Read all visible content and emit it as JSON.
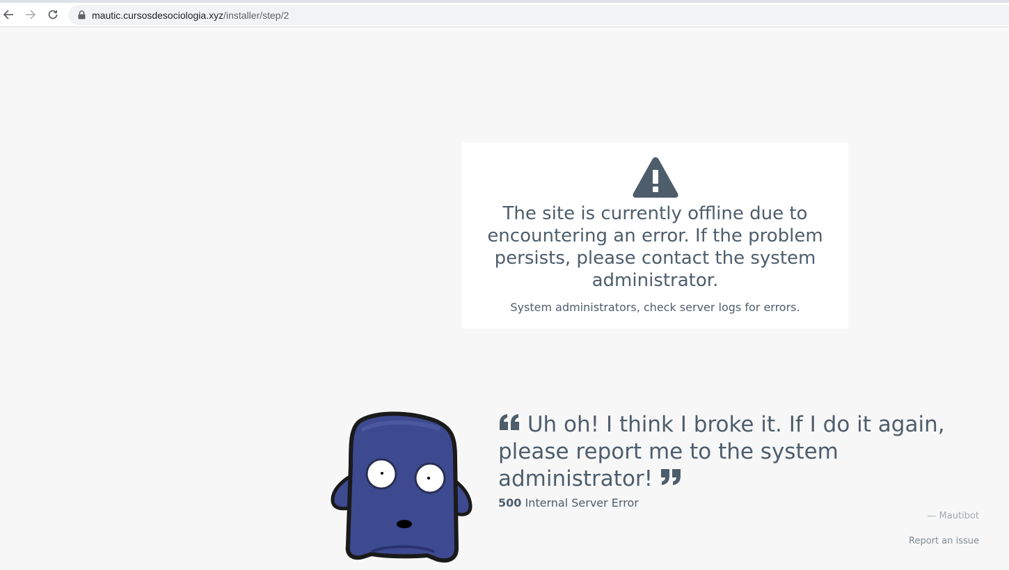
{
  "browser": {
    "url_host": "mautic.cursosdesociologia.xyz",
    "url_path": "/installer/step/2",
    "back_icon": "arrow-left-icon",
    "forward_icon": "arrow-right-icon",
    "reload_icon": "reload-icon",
    "lock_icon": "lock-icon"
  },
  "error_card": {
    "icon": "warning-triangle-icon",
    "message": "The site is currently offline due to encountering an error. If the problem persists, please contact the system administrator.",
    "sub_message": "System administrators, check server logs for errors."
  },
  "mautibot": {
    "quote": "Uh oh! I think I broke it. If I do it again, please report me to the system administrator!",
    "error_code": "500",
    "error_text": "Internal Server Error",
    "attribution": "— Mautibot",
    "report_link": "Report an issue"
  },
  "colors": {
    "page_bg": "#f7f7f7",
    "text": "#4e5d6c",
    "mautibot_body": "#3d4a8f"
  }
}
